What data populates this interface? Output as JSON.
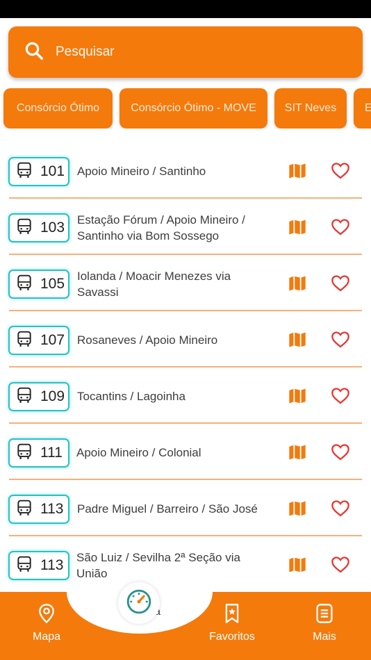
{
  "search": {
    "placeholder": "Pesquisar"
  },
  "chips": [
    {
      "label": "Consórcio Ótimo"
    },
    {
      "label": "Consórcio Ótimo - MOVE"
    },
    {
      "label": "SIT Neves"
    },
    {
      "label": "E"
    }
  ],
  "routes": [
    {
      "number": "101",
      "name": "Apoio Mineiro / Santinho"
    },
    {
      "number": "103",
      "name": "Estação Fórum / Apoio Mineiro / Santinho via Bom Sossego"
    },
    {
      "number": "105",
      "name": "Iolanda / Moacir Menezes via Savassi"
    },
    {
      "number": "107",
      "name": "Rosaneves / Apoio Mineiro"
    },
    {
      "number": "109",
      "name": "Tocantins / Lagoinha"
    },
    {
      "number": "111",
      "name": "Apoio Mineiro / Colonial"
    },
    {
      "number": "113",
      "name": "Padre Miguel / Barreiro / São José"
    },
    {
      "number": "113",
      "name": "São Luiz / Sevilha 2ª Seção via União"
    }
  ],
  "nav": {
    "mapa": "Mapa",
    "center": "Seg   Na",
    "favoritos": "Favoritos",
    "mais": "Mais"
  },
  "colors": {
    "accent": "#f47a0c",
    "badge_border": "#23c4c4",
    "heart": "#e53935",
    "divider": "#f6b07a"
  },
  "icons": {
    "search": "search-icon",
    "bus": "bus-icon",
    "map": "map-icon",
    "heart": "heart-icon",
    "location": "location-pin-icon",
    "favorites": "bookmark-star-icon",
    "more": "menu-list-icon",
    "center": "speedometer-icon"
  }
}
